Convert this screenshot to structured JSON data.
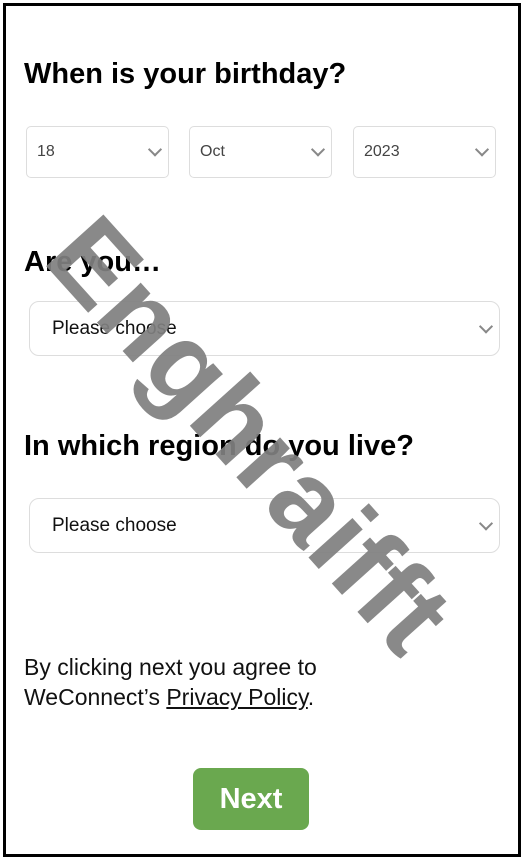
{
  "birthday": {
    "title": "When is your birthday?",
    "day": "18",
    "month": "Oct",
    "year": "2023"
  },
  "gender": {
    "title": "Are you…",
    "value": "Please choose"
  },
  "region": {
    "title": "In which region do you live?",
    "value": "Please choose"
  },
  "terms": {
    "line1": "By clicking next you agree to",
    "prefix": "WeConnect’s ",
    "link": "Privacy Policy",
    "suffix": "."
  },
  "next_label": "Next",
  "watermark": "Enghraifft",
  "colors": {
    "accent": "#6aa84f",
    "watermark": "#808080"
  }
}
